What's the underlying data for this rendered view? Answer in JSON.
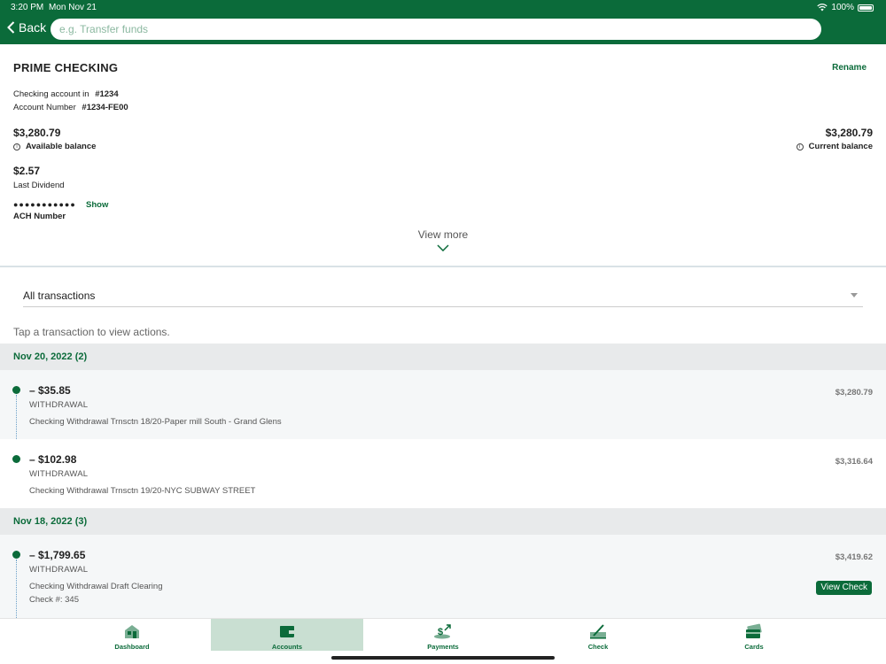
{
  "status_bar": {
    "time": "3:20 PM",
    "date": "Mon Nov 21",
    "battery": "100%"
  },
  "nav": {
    "back_label": "Back",
    "search_placeholder": "e.g. Transfer funds"
  },
  "account": {
    "title": "PRIME CHECKING",
    "rename_label": "Rename",
    "checking_label": "Checking account in",
    "checking_value": "#1234",
    "number_label": "Account Number",
    "number_value": "#1234-FE00",
    "available_balance": "$3,280.79",
    "available_label": "Available balance",
    "current_balance": "$3,280.79",
    "current_label": "Current balance",
    "dividend_value": "$2.57",
    "dividend_label": "Last Dividend",
    "ach_masked": "●●●●●●●●●●●",
    "ach_show": "Show",
    "ach_label": "ACH Number",
    "view_more": "View more"
  },
  "filter": {
    "selected": "All transactions"
  },
  "hint": "Tap a transaction to view actions.",
  "groups": [
    {
      "header": "Nov 20, 2022 (2)",
      "transactions": [
        {
          "amount": "– $35.85",
          "type": "WITHDRAWAL",
          "description": "Checking Withdrawal Trnsctn 18/20-Paper mill South - Grand Glens",
          "balance": "$3,280.79"
        },
        {
          "amount": "– $102.98",
          "type": "WITHDRAWAL",
          "description": "Checking Withdrawal Trnsctn 19/20-NYC SUBWAY STREET",
          "balance": "$3,316.64"
        }
      ]
    },
    {
      "header": "Nov 18, 2022 (3)",
      "transactions": [
        {
          "amount": "– $1,799.65",
          "type": "WITHDRAWAL",
          "description": "Checking Withdrawal Draft Clearing",
          "check": "Check #: 345",
          "balance": "$3,419.62",
          "action": "View Check"
        }
      ]
    }
  ],
  "tabs": [
    {
      "label": "Dashboard",
      "icon": "home-icon"
    },
    {
      "label": "Accounts",
      "icon": "wallet-icon",
      "active": true
    },
    {
      "label": "Payments",
      "icon": "payments-icon"
    },
    {
      "label": "Check",
      "icon": "check-deposit-icon"
    },
    {
      "label": "Cards",
      "icon": "cards-icon"
    }
  ],
  "colors": {
    "brand": "#0b6b3a",
    "active_tab": "#c9dfd2",
    "group_header": "#e8eaeb"
  }
}
